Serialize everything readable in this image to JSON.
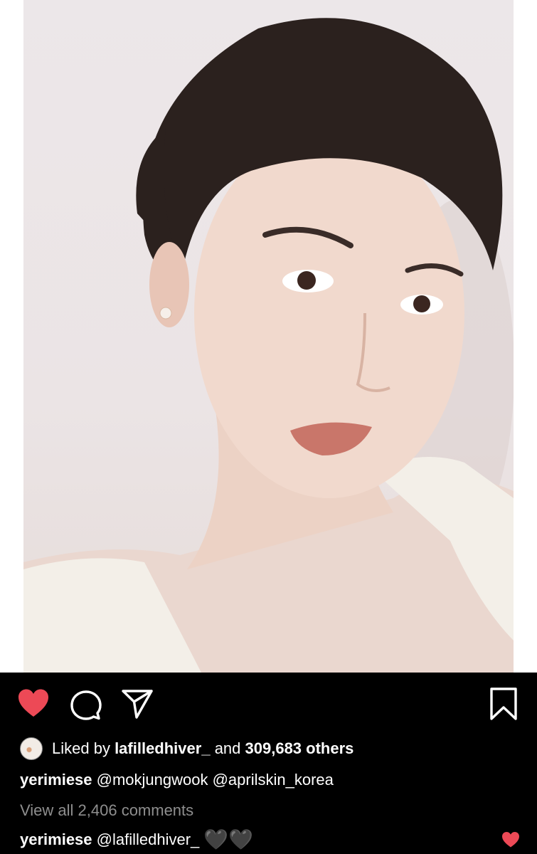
{
  "post": {
    "photo_label": "portrait photo",
    "actions": {
      "like_icon": "heart-filled-icon",
      "comment_icon": "comment-bubble-icon",
      "share_icon": "paper-plane-icon",
      "save_icon": "bookmark-icon",
      "like_color": "#ed4956"
    },
    "likes": {
      "prefix": "Liked by ",
      "user": "lafilledhiver_",
      "connector": " and ",
      "count_text": "309,683 others"
    },
    "caption": {
      "username": "yerimiese",
      "text": " @mokjungwook @aprilskin_korea"
    },
    "view_comments": "View all 2,406 comments",
    "comment": {
      "username": "yerimiese",
      "text": " @lafilledhiver_ ",
      "hearts": "🖤🖤"
    }
  }
}
